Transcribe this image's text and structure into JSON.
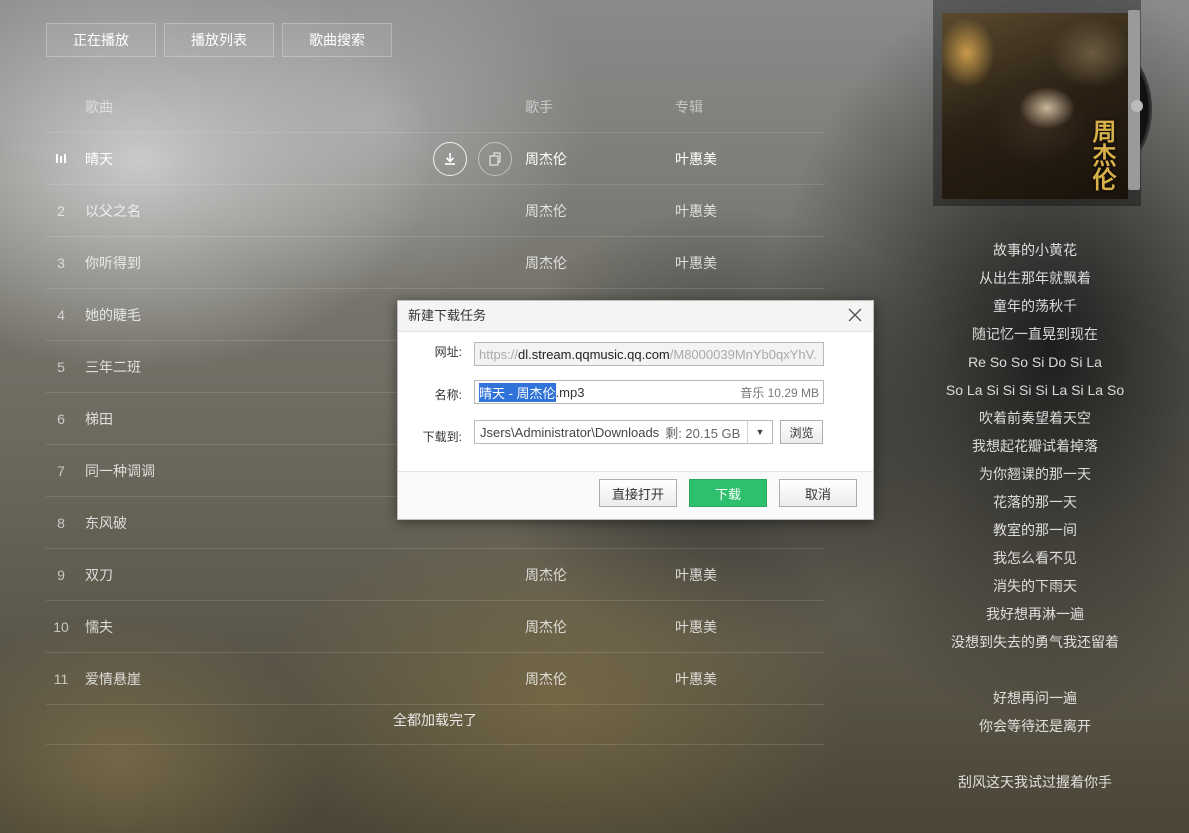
{
  "tabs": [
    "正在播放",
    "播放列表",
    "歌曲搜索"
  ],
  "list_header": {
    "song": "歌曲",
    "singer": "歌手",
    "album": "专辑"
  },
  "songs": [
    {
      "num": "",
      "name": "晴天",
      "singer": "周杰伦",
      "album": "叶惠美",
      "playing": true
    },
    {
      "num": "2",
      "name": "以父之名",
      "singer": "周杰伦",
      "album": "叶惠美"
    },
    {
      "num": "3",
      "name": "你听得到",
      "singer": "周杰伦",
      "album": "叶惠美"
    },
    {
      "num": "4",
      "name": "她的睫毛",
      "singer": "",
      "album": ""
    },
    {
      "num": "5",
      "name": "三年二班",
      "singer": "",
      "album": ""
    },
    {
      "num": "6",
      "name": "梯田",
      "singer": "",
      "album": ""
    },
    {
      "num": "7",
      "name": "同一种调调",
      "singer": "",
      "album": ""
    },
    {
      "num": "8",
      "name": "东风破",
      "singer": "",
      "album": ""
    },
    {
      "num": "9",
      "name": "双刀",
      "singer": "周杰伦",
      "album": "叶惠美"
    },
    {
      "num": "10",
      "name": "懦夫",
      "singer": "周杰伦",
      "album": "叶惠美"
    },
    {
      "num": "11",
      "name": "爱情悬崖",
      "singer": "周杰伦",
      "album": "叶惠美"
    }
  ],
  "loaded_text": "全都加载完了",
  "icons": {
    "playing": "equalizer-bars-icon",
    "download": "download-icon",
    "share": "share-icon",
    "close": "close-icon",
    "dropdown": "chevron-down-icon"
  },
  "album": {
    "logo_text": "周杰伦"
  },
  "lyrics": [
    "故事的小黄花",
    "从出生那年就飘着",
    "童年的荡秋千",
    "随记忆一直晃到现在",
    "Re So So Si Do Si La",
    "So La Si Si Si Si La Si La So",
    "吹着前奏望着天空",
    "我想起花瓣试着掉落",
    "为你翘课的那一天",
    "花落的那一天",
    "教室的那一间",
    "我怎么看不见",
    "消失的下雨天",
    "我好想再淋一遍",
    "没想到失去的勇气我还留着",
    "",
    "好想再问一遍",
    "你会等待还是离开",
    "",
    "刮风这天我试过握着你手"
  ],
  "dialog": {
    "title": "新建下载任务",
    "url_label": "网址:",
    "url_prefix": "https://",
    "url_host": "dl.stream.qqmusic.qq.com",
    "url_rest": "/M8000039MnYb0qxYhV.",
    "name_label": "名称:",
    "name_selected": "晴天 - 周杰伦",
    "name_ext": ".mp3",
    "size_text": "音乐 10.29 MB",
    "dest_label": "下载到:",
    "dest_path": "Jsers\\Administrator\\Downloads",
    "free_space": "剩: 20.15 GB",
    "browse": "浏览",
    "open_directly": "直接打开",
    "download": "下载",
    "cancel": "取消"
  },
  "colors": {
    "download_button": "#2fc06e",
    "selection": "#3074d9"
  }
}
